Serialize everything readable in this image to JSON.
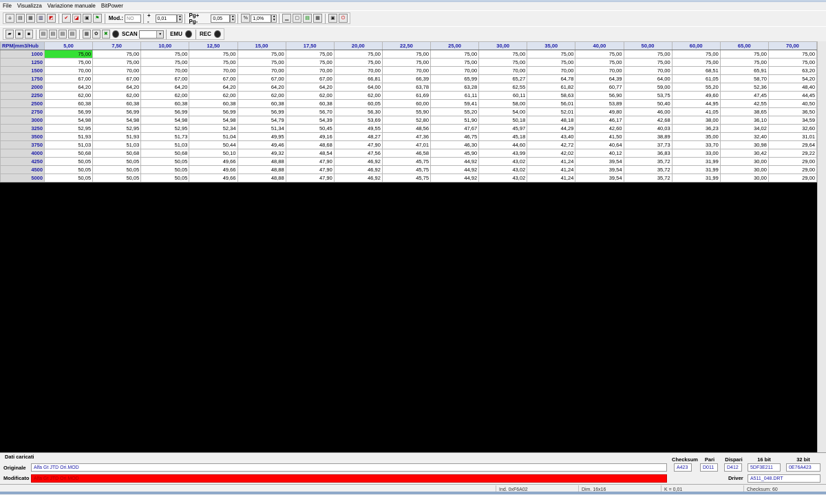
{
  "menu": [
    "File",
    "Visualizza",
    "Variazione manuale",
    "BitPower"
  ],
  "toolbar1": {
    "mod_label": "Mod.:",
    "mod_value": "NO",
    "plusminus_label": "+ -",
    "step_value": "0,01",
    "pg_label": "Pg+ Pg-",
    "pg_value": "0,05",
    "percent_value": "1,0%"
  },
  "toolbar2": {
    "scan_label": "SCAN",
    "emu_label": "EMU",
    "rec_label": "REC"
  },
  "table": {
    "corner": "RPM|mm3/Hub",
    "columns": [
      "5,00",
      "7,50",
      "10,00",
      "12,50",
      "15,00",
      "17,50",
      "20,00",
      "22,50",
      "25,00",
      "30,00",
      "35,00",
      "40,00",
      "50,00",
      "60,00",
      "65,00",
      "70,00"
    ],
    "rows": [
      {
        "rpm": "1000",
        "values": [
          "75,00",
          "75,00",
          "75,00",
          "75,00",
          "75,00",
          "75,00",
          "75,00",
          "75,00",
          "75,00",
          "75,00",
          "75,00",
          "75,00",
          "75,00",
          "75,00",
          "75,00",
          "75,00"
        ]
      },
      {
        "rpm": "1250",
        "values": [
          "75,00",
          "75,00",
          "75,00",
          "75,00",
          "75,00",
          "75,00",
          "75,00",
          "75,00",
          "75,00",
          "75,00",
          "75,00",
          "75,00",
          "75,00",
          "75,00",
          "75,00",
          "75,00"
        ]
      },
      {
        "rpm": "1500",
        "values": [
          "70,00",
          "70,00",
          "70,00",
          "70,00",
          "70,00",
          "70,00",
          "70,00",
          "70,00",
          "70,00",
          "70,00",
          "70,00",
          "70,00",
          "70,00",
          "68,51",
          "65,91",
          "63,20"
        ]
      },
      {
        "rpm": "1750",
        "values": [
          "67,00",
          "67,00",
          "67,00",
          "67,00",
          "67,00",
          "67,00",
          "66,81",
          "66,39",
          "65,99",
          "65,27",
          "64,78",
          "64,39",
          "64,00",
          "61,05",
          "58,70",
          "54,20"
        ]
      },
      {
        "rpm": "2000",
        "values": [
          "64,20",
          "64,20",
          "64,20",
          "64,20",
          "64,20",
          "64,20",
          "64,00",
          "63,78",
          "63,28",
          "62,55",
          "61,82",
          "60,77",
          "59,00",
          "55,20",
          "52,36",
          "48,40"
        ]
      },
      {
        "rpm": "2250",
        "values": [
          "62,00",
          "62,00",
          "62,00",
          "62,00",
          "62,00",
          "62,00",
          "62,00",
          "61,69",
          "61,11",
          "60,11",
          "58,63",
          "56,90",
          "53,75",
          "49,60",
          "47,45",
          "44,45"
        ]
      },
      {
        "rpm": "2500",
        "values": [
          "60,38",
          "60,38",
          "60,38",
          "60,38",
          "60,38",
          "60,38",
          "60,05",
          "60,00",
          "59,41",
          "58,00",
          "56,01",
          "53,89",
          "50,40",
          "44,95",
          "42,55",
          "40,50"
        ]
      },
      {
        "rpm": "2750",
        "values": [
          "56,99",
          "56,99",
          "56,99",
          "56,99",
          "56,99",
          "56,70",
          "56,30",
          "55,90",
          "55,20",
          "54,00",
          "52,01",
          "49,80",
          "46,00",
          "41,05",
          "38,65",
          "36,50"
        ]
      },
      {
        "rpm": "3000",
        "values": [
          "54,98",
          "54,98",
          "54,98",
          "54,98",
          "54,79",
          "54,39",
          "53,69",
          "52,80",
          "51,90",
          "50,18",
          "48,18",
          "46,17",
          "42,68",
          "38,00",
          "36,10",
          "34,59"
        ]
      },
      {
        "rpm": "3250",
        "values": [
          "52,95",
          "52,95",
          "52,95",
          "52,34",
          "51,34",
          "50,45",
          "49,55",
          "48,56",
          "47,67",
          "45,97",
          "44,29",
          "42,60",
          "40,03",
          "36,23",
          "34,02",
          "32,60"
        ]
      },
      {
        "rpm": "3500",
        "values": [
          "51,93",
          "51,93",
          "51,73",
          "51,04",
          "49,95",
          "49,16",
          "48,27",
          "47,36",
          "46,75",
          "45,18",
          "43,40",
          "41,50",
          "38,89",
          "35,00",
          "32,40",
          "31,01"
        ]
      },
      {
        "rpm": "3750",
        "values": [
          "51,03",
          "51,03",
          "51,03",
          "50,44",
          "49,46",
          "48,68",
          "47,90",
          "47,01",
          "46,30",
          "44,60",
          "42,72",
          "40,64",
          "37,73",
          "33,70",
          "30,98",
          "29,64"
        ]
      },
      {
        "rpm": "4000",
        "values": [
          "50,68",
          "50,68",
          "50,68",
          "50,10",
          "49,32",
          "48,54",
          "47,56",
          "46,58",
          "45,90",
          "43,99",
          "42,02",
          "40,12",
          "36,83",
          "33,00",
          "30,42",
          "29,22"
        ]
      },
      {
        "rpm": "4250",
        "values": [
          "50,05",
          "50,05",
          "50,05",
          "49,66",
          "48,88",
          "47,90",
          "46,92",
          "45,75",
          "44,92",
          "43,02",
          "41,24",
          "39,54",
          "35,72",
          "31,99",
          "30,00",
          "29,00"
        ]
      },
      {
        "rpm": "4500",
        "values": [
          "50,05",
          "50,05",
          "50,05",
          "49,66",
          "48,88",
          "47,90",
          "46,92",
          "45,75",
          "44,92",
          "43,02",
          "41,24",
          "39,54",
          "35,72",
          "31,99",
          "30,00",
          "29,00"
        ]
      },
      {
        "rpm": "5000",
        "values": [
          "50,05",
          "50,05",
          "50,05",
          "49,66",
          "48,88",
          "47,90",
          "46,92",
          "45,75",
          "44,92",
          "43,02",
          "41,24",
          "39,54",
          "35,72",
          "31,99",
          "30,00",
          "29,00"
        ]
      }
    ]
  },
  "panel": {
    "title": "Dati caricati",
    "original_label": "Originale",
    "original_value": "Alfa Gt JTD Ori.MOD",
    "modified_label": "Modificato",
    "modified_value": "Alfa Gt JTD Ori.MOD",
    "checksum_label": "Checksum",
    "checksum_value": "A423",
    "pari_label": "Pari",
    "pari_value": "D011",
    "dispari_label": "Dispari",
    "dispari_value": "D412",
    "bit16_label": "16 bit",
    "bit16_value": "5DF3E211",
    "bit32_label": "32 bit",
    "bit32_value": "0E76A423",
    "driver_label": "Driver",
    "driver_value": "A511_048.DRT"
  },
  "status": {
    "ind": "Ind. 0xF6A02",
    "dim": "Dim. 16x16",
    "k": "K = 0,01",
    "checksum": "Checksum: 60"
  },
  "colors": {
    "selected_cell": "#35e035",
    "modified_field": "#ff0000",
    "header_text": "#1a1aa8"
  }
}
